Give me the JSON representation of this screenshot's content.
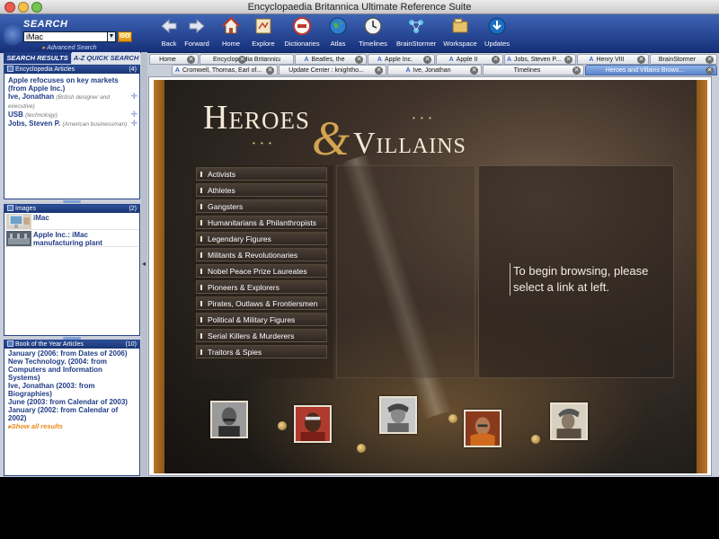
{
  "window": {
    "title": "Encyclopaedia Britannica Ultimate Reference Suite"
  },
  "search": {
    "label": "SEARCH",
    "query": "iMac",
    "go_label": "GO",
    "advanced_label": "Advanced Search"
  },
  "toolbar": {
    "buttons": [
      {
        "label": "Back",
        "icon": "back-arrow-icon"
      },
      {
        "label": "Forward",
        "icon": "forward-arrow-icon"
      },
      {
        "label": "Home",
        "icon": "home-icon"
      },
      {
        "label": "Explore",
        "icon": "explore-icon"
      },
      {
        "label": "Dictionaries",
        "icon": "dictionary-icon"
      },
      {
        "label": "Atlas",
        "icon": "globe-icon"
      },
      {
        "label": "Timelines",
        "icon": "clock-icon"
      },
      {
        "label": "BrainStormer",
        "icon": "brainstormer-icon"
      },
      {
        "label": "Workspace",
        "icon": "workspace-icon"
      },
      {
        "label": "Updates",
        "icon": "updates-icon"
      }
    ]
  },
  "left": {
    "tabs": [
      {
        "label": "SEARCH RESULTS"
      },
      {
        "label": "A-Z QUICK SEARCH"
      }
    ],
    "articles": {
      "title": "Encyclopedia Articles",
      "count": "(4)",
      "items": [
        {
          "text": "Apple refocuses on key markets (from Apple Inc.)",
          "note": ""
        },
        {
          "text": "Ive, Jonathan",
          "note": "(British designer and executive)"
        },
        {
          "text": "USB",
          "note": "(technology)"
        },
        {
          "text": "Jobs, Steven P.",
          "note": "(American businessman)"
        }
      ]
    },
    "images": {
      "title": "Images",
      "count": "(2)",
      "items": [
        {
          "caption": "iMac"
        },
        {
          "caption": "Apple Inc.: iMac manufacturing plant"
        }
      ]
    },
    "yearbook": {
      "title": "Book of the Year Articles",
      "count": "(10)",
      "items": [
        {
          "text": "January (2006: from Dates of 2006)"
        },
        {
          "text": "New Technology. (2004: from Computers and Information Systems)"
        },
        {
          "text": "Ive, Jonathan (2003: from Biographies)"
        },
        {
          "text": "June (2003: from Calendar of 2003)"
        },
        {
          "text": "January (2002: from Calendar of 2002)"
        }
      ],
      "show_all": "Show all results"
    }
  },
  "tabs": {
    "row1": [
      {
        "label": "Home",
        "prefix": ""
      },
      {
        "label": "Encyclopædia Britannica",
        "prefix": ""
      },
      {
        "label": "Beatles, the",
        "prefix": "A"
      },
      {
        "label": "Apple Inc.",
        "prefix": "A"
      },
      {
        "label": "Apple II",
        "prefix": "A"
      },
      {
        "label": "Jobs, Steven P...",
        "prefix": "A"
      },
      {
        "label": "Henry VIII",
        "prefix": "A"
      },
      {
        "label": "BrainStormer",
        "prefix": ""
      }
    ],
    "row2": [
      {
        "label": "Cromwell, Thomas, Earl of...",
        "prefix": "A"
      },
      {
        "label": "Update Center : knightho...",
        "prefix": ""
      },
      {
        "label": "Ive, Jonathan",
        "prefix": "A"
      },
      {
        "label": "Timelines",
        "prefix": ""
      },
      {
        "label": "Heroes and Villains Brows...",
        "prefix": ""
      }
    ]
  },
  "heroes": {
    "title_left": "Heroes",
    "ampersand": "&",
    "title_right": "Villains",
    "dots": "• • •",
    "categories": [
      "Activists",
      "Athletes",
      "Gangsters",
      "Humanitarians & Philanthropists",
      "Legendary Figures",
      "Militants & Revolutionaries",
      "Nobel Peace Prize Laureates",
      "Pioneers & Explorers",
      "Pirates, Outlaws & Frontiersmen",
      "Political & Military Figures",
      "Serial Killers & Murderers",
      "Traitors & Spies"
    ],
    "prompt": "To begin browsing, please select a link at left."
  },
  "colors": {
    "toolbar": "#1f3c86",
    "link": "#1f3c86",
    "accent": "#e8891a",
    "frame": "#b9772a"
  }
}
